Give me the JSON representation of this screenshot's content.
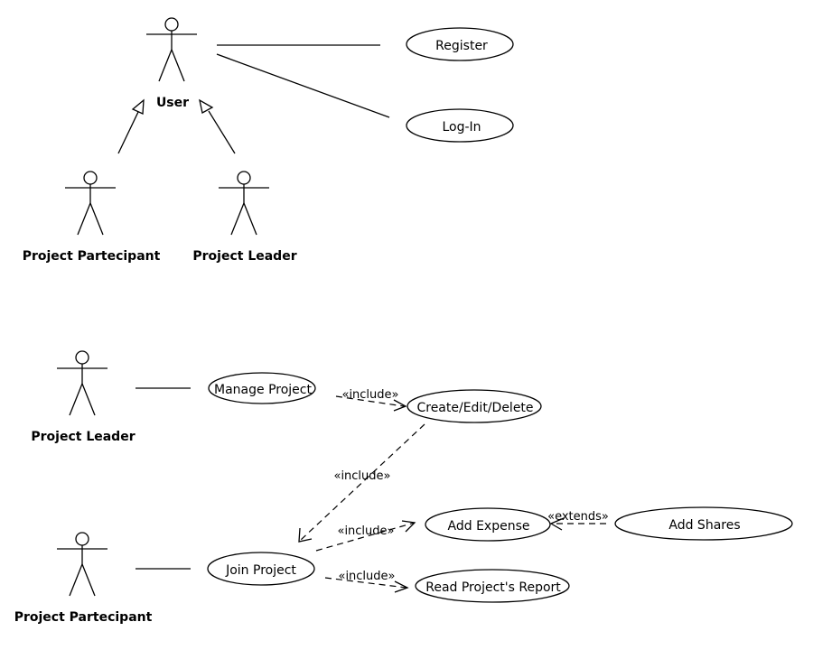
{
  "diagram": {
    "type": "UML use case diagram",
    "colors": {
      "stroke": "#000000",
      "background": "#ffffff"
    }
  },
  "actors": {
    "user": {
      "label": "User"
    },
    "participant_top": {
      "label": "Project Partecipant"
    },
    "leader_top": {
      "label": "Project Leader"
    },
    "leader_bottom": {
      "label": "Project Leader"
    },
    "participant_bottom": {
      "label": "Project Partecipant"
    }
  },
  "use_cases": {
    "register": {
      "label": "Register"
    },
    "login": {
      "label": "Log-In"
    },
    "manage_project": {
      "label": "Manage Project"
    },
    "create_edit_delete": {
      "label": "Create/Edit/Delete"
    },
    "join_project": {
      "label": "Join Project"
    },
    "add_expense": {
      "label": "Add Expense"
    },
    "add_shares": {
      "label": "Add Shares"
    },
    "read_report": {
      "label": "Read Project's Report"
    }
  },
  "relationships": {
    "manage_to_create": {
      "stereotype": "«include»",
      "from": "Manage Project",
      "to": "Create/Edit/Delete"
    },
    "create_to_join": {
      "stereotype": "«include»",
      "from": "Create/Edit/Delete",
      "to": "Join Project"
    },
    "join_to_expense": {
      "stereotype": "«include»",
      "from": "Join Project",
      "to": "Add Expense"
    },
    "join_to_report": {
      "stereotype": "«include»",
      "from": "Join Project",
      "to": "Read Project's Report"
    },
    "shares_to_expense": {
      "stereotype": "«extends»",
      "from": "Add Shares",
      "to": "Add Expense"
    },
    "generalizations": [
      {
        "child": "Project Partecipant",
        "parent": "User"
      },
      {
        "child": "Project Leader",
        "parent": "User"
      }
    ],
    "associations": [
      {
        "actor": "User",
        "use_case": "Register"
      },
      {
        "actor": "User",
        "use_case": "Log-In"
      },
      {
        "actor": "Project Leader",
        "use_case": "Manage Project"
      },
      {
        "actor": "Project Partecipant",
        "use_case": "Join Project"
      }
    ]
  }
}
